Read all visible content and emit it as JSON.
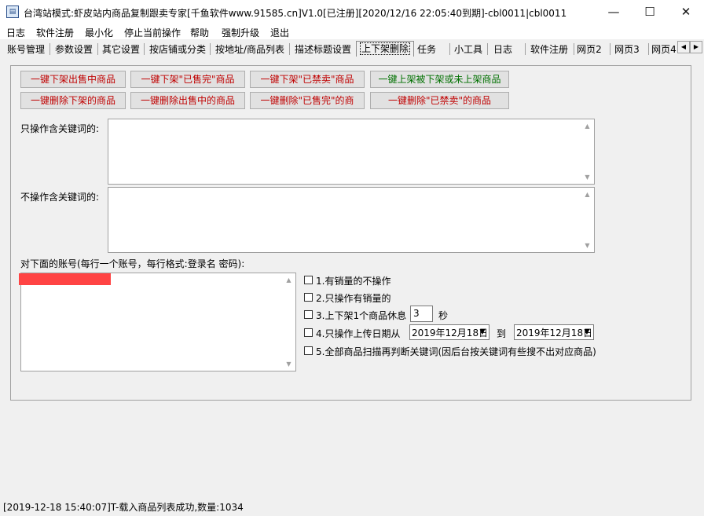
{
  "window": {
    "title": "台湾站模式:虾皮站内商品复制跟卖专家[千鱼软件www.91585.cn]V1.0[已注册][2020/12/16 22:05:40到期]-cbl0011|cbl0011",
    "minimize": "—",
    "maximize": "☐",
    "close": "✕"
  },
  "menu": [
    "日志",
    "软件注册",
    "最小化",
    "停止当前操作",
    "帮助",
    "强制升级",
    "退出"
  ],
  "tabs": [
    "账号管理",
    "参数设置",
    "其它设置",
    "按店铺或分类",
    "按地址/商品列表",
    "描述标题设置",
    "上下架删除",
    "任务",
    "小工具",
    "日志",
    "软件注册",
    "网页2",
    "网页3",
    "网页4"
  ],
  "buttons": {
    "row1": [
      "一键下架出售中商品",
      "一键下架\"已售完\"商品",
      "一键下架\"已禁卖\"商品",
      "一键上架被下架或未上架商品"
    ],
    "row2": [
      "一键删除下架的商品",
      "一键删除出售中的商品",
      "一键删除\"已售完\"的商",
      "一键删除\"已禁卖\"的商品"
    ]
  },
  "fields": {
    "include_label": "只操作含关键词的:",
    "exclude_label": "不操作含关键词的:",
    "accounts_label": "对下面的账号(每行一个账号，每行格式:登录名 密码):"
  },
  "options": {
    "opt1": "1.有销量的不操作",
    "opt2": "2.只操作有销量的",
    "opt3": "3.上下架1个商品休息",
    "opt3_value": "3",
    "opt3_unit": "秒",
    "opt4": "4.只操作上传日期从",
    "opt4_from": "2019年12月18日",
    "opt4_to_label": "到",
    "opt4_to": "2019年12月18日",
    "opt5": "5.全部商品扫描再判断关键词(因后台按关键词有些搜不出对应商品)"
  },
  "status": "[2019-12-18 15:40:07]T-载入商品列表成功,数量:1034",
  "colors": {
    "button_red": "#c00000",
    "button_green": "#007000",
    "redaction": "#ff4444"
  }
}
